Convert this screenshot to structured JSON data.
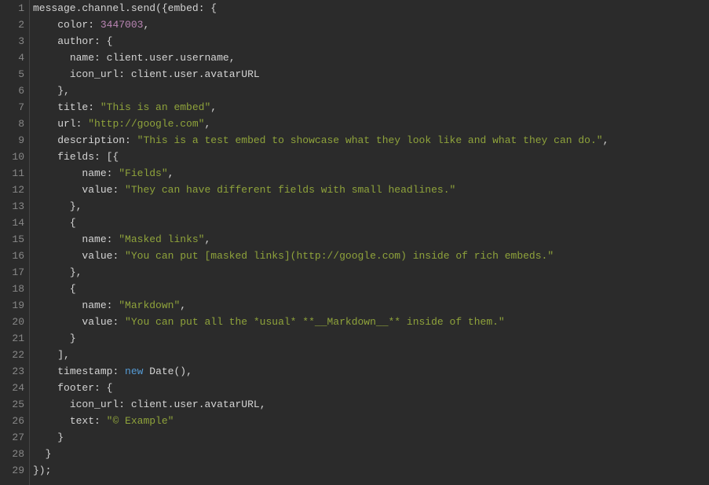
{
  "editor": {
    "lineCount": 29,
    "lines": [
      {
        "n": 1,
        "tokens": [
          {
            "t": "message",
            "c": "tok-default"
          },
          {
            "t": ".",
            "c": "tok-punc"
          },
          {
            "t": "channel",
            "c": "tok-default"
          },
          {
            "t": ".",
            "c": "tok-punc"
          },
          {
            "t": "send",
            "c": "tok-method"
          },
          {
            "t": "({",
            "c": "tok-punc"
          },
          {
            "t": "embed",
            "c": "tok-key"
          },
          {
            "t": ": {",
            "c": "tok-punc"
          }
        ]
      },
      {
        "n": 2,
        "indent": 4,
        "tokens": [
          {
            "t": "color",
            "c": "tok-key"
          },
          {
            "t": ": ",
            "c": "tok-punc"
          },
          {
            "t": "3447003",
            "c": "tok-number"
          },
          {
            "t": ",",
            "c": "tok-punc"
          }
        ]
      },
      {
        "n": 3,
        "indent": 4,
        "tokens": [
          {
            "t": "author",
            "c": "tok-key"
          },
          {
            "t": ": {",
            "c": "tok-punc"
          }
        ]
      },
      {
        "n": 4,
        "indent": 6,
        "tokens": [
          {
            "t": "name",
            "c": "tok-key"
          },
          {
            "t": ": ",
            "c": "tok-punc"
          },
          {
            "t": "client",
            "c": "tok-default"
          },
          {
            "t": ".",
            "c": "tok-punc"
          },
          {
            "t": "user",
            "c": "tok-default"
          },
          {
            "t": ".",
            "c": "tok-punc"
          },
          {
            "t": "username",
            "c": "tok-default"
          },
          {
            "t": ",",
            "c": "tok-punc"
          }
        ]
      },
      {
        "n": 5,
        "indent": 6,
        "tokens": [
          {
            "t": "icon_url",
            "c": "tok-key"
          },
          {
            "t": ": ",
            "c": "tok-punc"
          },
          {
            "t": "client",
            "c": "tok-default"
          },
          {
            "t": ".",
            "c": "tok-punc"
          },
          {
            "t": "user",
            "c": "tok-default"
          },
          {
            "t": ".",
            "c": "tok-punc"
          },
          {
            "t": "avatarURL",
            "c": "tok-default"
          }
        ]
      },
      {
        "n": 6,
        "indent": 4,
        "tokens": [
          {
            "t": "},",
            "c": "tok-punc"
          }
        ]
      },
      {
        "n": 7,
        "indent": 4,
        "tokens": [
          {
            "t": "title",
            "c": "tok-key"
          },
          {
            "t": ": ",
            "c": "tok-punc"
          },
          {
            "t": "\"This is an embed\"",
            "c": "tok-string"
          },
          {
            "t": ",",
            "c": "tok-punc"
          }
        ]
      },
      {
        "n": 8,
        "indent": 4,
        "tokens": [
          {
            "t": "url",
            "c": "tok-key"
          },
          {
            "t": ": ",
            "c": "tok-punc"
          },
          {
            "t": "\"http://google.com\"",
            "c": "tok-string"
          },
          {
            "t": ",",
            "c": "tok-punc"
          }
        ]
      },
      {
        "n": 9,
        "indent": 4,
        "tokens": [
          {
            "t": "description",
            "c": "tok-key"
          },
          {
            "t": ": ",
            "c": "tok-punc"
          },
          {
            "t": "\"This is a test embed to showcase what they look like and what they can do.\"",
            "c": "tok-string"
          },
          {
            "t": ",",
            "c": "tok-punc"
          }
        ]
      },
      {
        "n": 10,
        "indent": 4,
        "tokens": [
          {
            "t": "fields",
            "c": "tok-key"
          },
          {
            "t": ": [{",
            "c": "tok-punc"
          }
        ]
      },
      {
        "n": 11,
        "indent": 8,
        "tokens": [
          {
            "t": "name",
            "c": "tok-key"
          },
          {
            "t": ": ",
            "c": "tok-punc"
          },
          {
            "t": "\"Fields\"",
            "c": "tok-string"
          },
          {
            "t": ",",
            "c": "tok-punc"
          }
        ]
      },
      {
        "n": 12,
        "indent": 8,
        "tokens": [
          {
            "t": "value",
            "c": "tok-key"
          },
          {
            "t": ": ",
            "c": "tok-punc"
          },
          {
            "t": "\"They can have different fields with small headlines.\"",
            "c": "tok-string"
          }
        ]
      },
      {
        "n": 13,
        "indent": 6,
        "tokens": [
          {
            "t": "},",
            "c": "tok-punc"
          }
        ]
      },
      {
        "n": 14,
        "indent": 6,
        "tokens": [
          {
            "t": "{",
            "c": "tok-punc"
          }
        ]
      },
      {
        "n": 15,
        "indent": 8,
        "tokens": [
          {
            "t": "name",
            "c": "tok-key"
          },
          {
            "t": ": ",
            "c": "tok-punc"
          },
          {
            "t": "\"Masked links\"",
            "c": "tok-string"
          },
          {
            "t": ",",
            "c": "tok-punc"
          }
        ]
      },
      {
        "n": 16,
        "indent": 8,
        "tokens": [
          {
            "t": "value",
            "c": "tok-key"
          },
          {
            "t": ": ",
            "c": "tok-punc"
          },
          {
            "t": "\"You can put [masked links](http://google.com) inside of rich embeds.\"",
            "c": "tok-string"
          }
        ]
      },
      {
        "n": 17,
        "indent": 6,
        "tokens": [
          {
            "t": "},",
            "c": "tok-punc"
          }
        ]
      },
      {
        "n": 18,
        "indent": 6,
        "tokens": [
          {
            "t": "{",
            "c": "tok-punc"
          }
        ]
      },
      {
        "n": 19,
        "indent": 8,
        "tokens": [
          {
            "t": "name",
            "c": "tok-key"
          },
          {
            "t": ": ",
            "c": "tok-punc"
          },
          {
            "t": "\"Markdown\"",
            "c": "tok-string"
          },
          {
            "t": ",",
            "c": "tok-punc"
          }
        ]
      },
      {
        "n": 20,
        "indent": 8,
        "tokens": [
          {
            "t": "value",
            "c": "tok-key"
          },
          {
            "t": ": ",
            "c": "tok-punc"
          },
          {
            "t": "\"You can put all the *usual* **__Markdown__** inside of them.\"",
            "c": "tok-string"
          }
        ]
      },
      {
        "n": 21,
        "indent": 6,
        "tokens": [
          {
            "t": "}",
            "c": "tok-punc"
          }
        ]
      },
      {
        "n": 22,
        "indent": 4,
        "tokens": [
          {
            "t": "],",
            "c": "tok-punc"
          }
        ]
      },
      {
        "n": 23,
        "indent": 4,
        "tokens": [
          {
            "t": "timestamp",
            "c": "tok-key"
          },
          {
            "t": ": ",
            "c": "tok-punc"
          },
          {
            "t": "new",
            "c": "tok-keyword"
          },
          {
            "t": " ",
            "c": "tok-punc"
          },
          {
            "t": "Date",
            "c": "tok-default"
          },
          {
            "t": "(),",
            "c": "tok-punc"
          }
        ]
      },
      {
        "n": 24,
        "indent": 4,
        "tokens": [
          {
            "t": "footer",
            "c": "tok-key"
          },
          {
            "t": ": {",
            "c": "tok-punc"
          }
        ]
      },
      {
        "n": 25,
        "indent": 6,
        "tokens": [
          {
            "t": "icon_url",
            "c": "tok-key"
          },
          {
            "t": ": ",
            "c": "tok-punc"
          },
          {
            "t": "client",
            "c": "tok-default"
          },
          {
            "t": ".",
            "c": "tok-punc"
          },
          {
            "t": "user",
            "c": "tok-default"
          },
          {
            "t": ".",
            "c": "tok-punc"
          },
          {
            "t": "avatarURL",
            "c": "tok-default"
          },
          {
            "t": ",",
            "c": "tok-punc"
          }
        ]
      },
      {
        "n": 26,
        "indent": 6,
        "tokens": [
          {
            "t": "text",
            "c": "tok-key"
          },
          {
            "t": ": ",
            "c": "tok-punc"
          },
          {
            "t": "\"© Example\"",
            "c": "tok-string"
          }
        ]
      },
      {
        "n": 27,
        "indent": 4,
        "tokens": [
          {
            "t": "}",
            "c": "tok-punc"
          }
        ]
      },
      {
        "n": 28,
        "indent": 2,
        "tokens": [
          {
            "t": "}",
            "c": "tok-punc"
          }
        ]
      },
      {
        "n": 29,
        "indent": 0,
        "tokens": [
          {
            "t": "});",
            "c": "tok-punc"
          }
        ]
      }
    ]
  }
}
